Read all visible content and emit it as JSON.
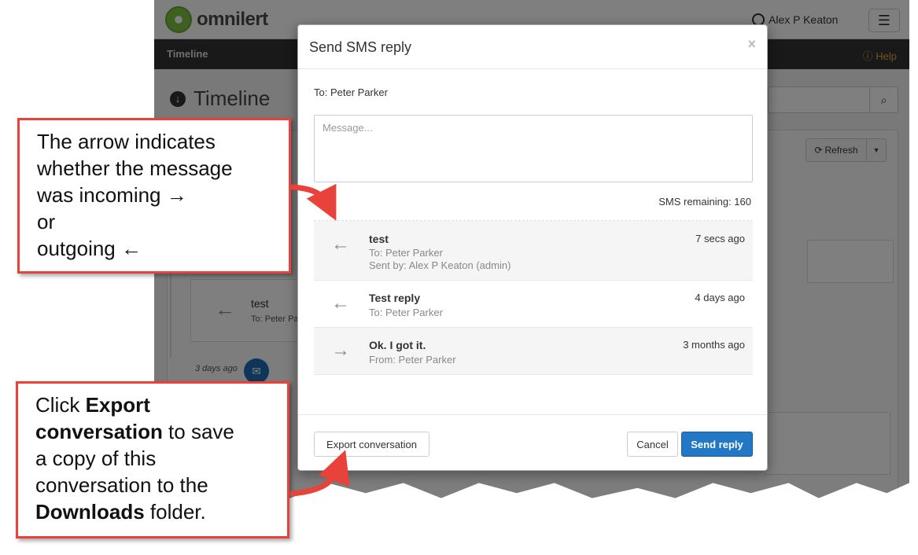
{
  "app": {
    "brand": "omnilert",
    "user_name": "Alex P Keaton",
    "menu_icon": "hamburger-icon",
    "nav_title": "Timeline",
    "help_label": "Help",
    "page_title": "Timeline",
    "refresh_label": "Refresh",
    "bg_card_title": "test",
    "bg_card_to": "To: Peter Pa",
    "bg_date": "3 days ago"
  },
  "modal": {
    "title": "Send SMS reply",
    "close_label": "×",
    "to_line": "To: Peter Parker",
    "message_placeholder": "Message...",
    "sms_remaining": "SMS remaining: 160",
    "messages": [
      {
        "direction": "outgoing",
        "arrow": "←",
        "title": "test",
        "meta1": "To: Peter Parker",
        "meta2": "Sent by: Alex P Keaton (admin)",
        "time": "7 secs ago"
      },
      {
        "direction": "outgoing",
        "arrow": "←",
        "title": "Test reply",
        "meta1": "To: Peter Parker",
        "time": "4 days ago"
      },
      {
        "direction": "incoming",
        "arrow": "→",
        "title": "Ok. I got it.",
        "meta1": "From: Peter Parker",
        "time": "3 months ago"
      }
    ],
    "export_label": "Export conversation",
    "cancel_label": "Cancel",
    "send_label": "Send reply"
  },
  "callouts": {
    "arrow_note": {
      "line1": "The arrow indicates",
      "line2": "whether the message",
      "line3": "was incoming →",
      "line4": "or",
      "line5": "outgoing ←"
    },
    "export_note": {
      "part1": "Click ",
      "bold1": "Export",
      "bold2": "conversation",
      "part2": " to save",
      "line3": "a copy of this",
      "line4": "conversation to the",
      "bold3": "Downloads",
      "part3": " folder."
    }
  },
  "colors": {
    "accent": "#e8423b",
    "primary_button": "#2378c5",
    "help_link": "#e8a33d"
  }
}
